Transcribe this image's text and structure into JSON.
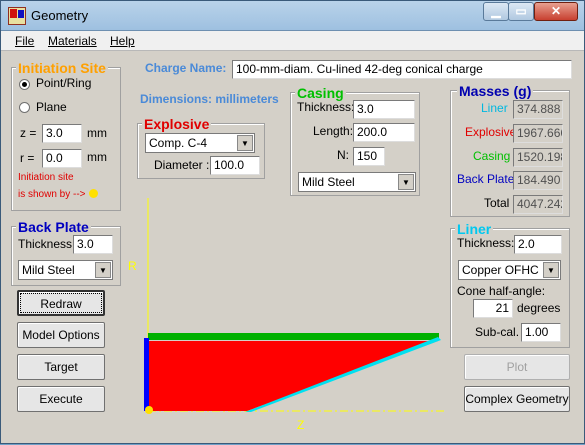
{
  "window": {
    "title": "Geometry"
  },
  "menu": {
    "file": "File",
    "materials": "Materials",
    "help": "Help"
  },
  "initiation": {
    "title": "Initiation Site",
    "radio_point": "Point/Ring",
    "radio_plane": "Plane",
    "z_label": "z =",
    "z_value": "3.0",
    "z_unit": "mm",
    "r_label": "r =",
    "r_value": "0.0",
    "r_unit": "mm",
    "note_line1": "Initiation site",
    "note_line2": "is shown by -->"
  },
  "charge": {
    "label": "Charge Name:",
    "value": "100-mm-diam. Cu-lined 42-deg conical charge",
    "dimensions": "Dimensions: millimeters"
  },
  "explosive": {
    "title": "Explosive",
    "material": "Comp. C-4",
    "diameter_label": "Diameter :",
    "diameter_value": "100.0"
  },
  "casing": {
    "title": "Casing",
    "thickness_label": "Thickness:",
    "thickness_value": "3.0",
    "length_label": "Length:",
    "length_value": "200.0",
    "n_label": "N:",
    "n_value": "150",
    "material": "Mild Steel"
  },
  "masses": {
    "title": "Masses (g)",
    "liner_label": "Liner",
    "liner_value": "374.888",
    "explosive_label": "Explosive",
    "explosive_value": "1967.666",
    "casing_label": "Casing",
    "casing_value": "1520.198",
    "backplate_label": "Back Plate",
    "backplate_value": "184.490",
    "total_label": "Total",
    "total_value": "4047.242"
  },
  "backplate": {
    "title": "Back Plate",
    "thickness_label": "Thickness:",
    "thickness_value": "3.0",
    "material": "Mild Steel"
  },
  "liner": {
    "title": "Liner",
    "thickness_label": "Thickness:",
    "thickness_value": "2.0",
    "material": "Copper OFHC",
    "cone_label": "Cone half-angle:",
    "cone_value": "21",
    "cone_unit": "degrees",
    "subcal_label": "Sub-cal.",
    "subcal_value": "1.00"
  },
  "buttons": {
    "redraw": "Redraw",
    "model_options": "Model Options",
    "target": "Target",
    "execute": "Execute",
    "plot": "Plot",
    "complex_geometry": "Complex Geometry"
  },
  "plot": {
    "r_axis": "R",
    "z_axis": "Z"
  },
  "colors": {
    "explosive": "#ff0000",
    "casing": "#00b000",
    "liner": "#00e0f0",
    "backplate": "#0000ff",
    "axis": "#ffff00",
    "init_dot": "#ffe000"
  }
}
